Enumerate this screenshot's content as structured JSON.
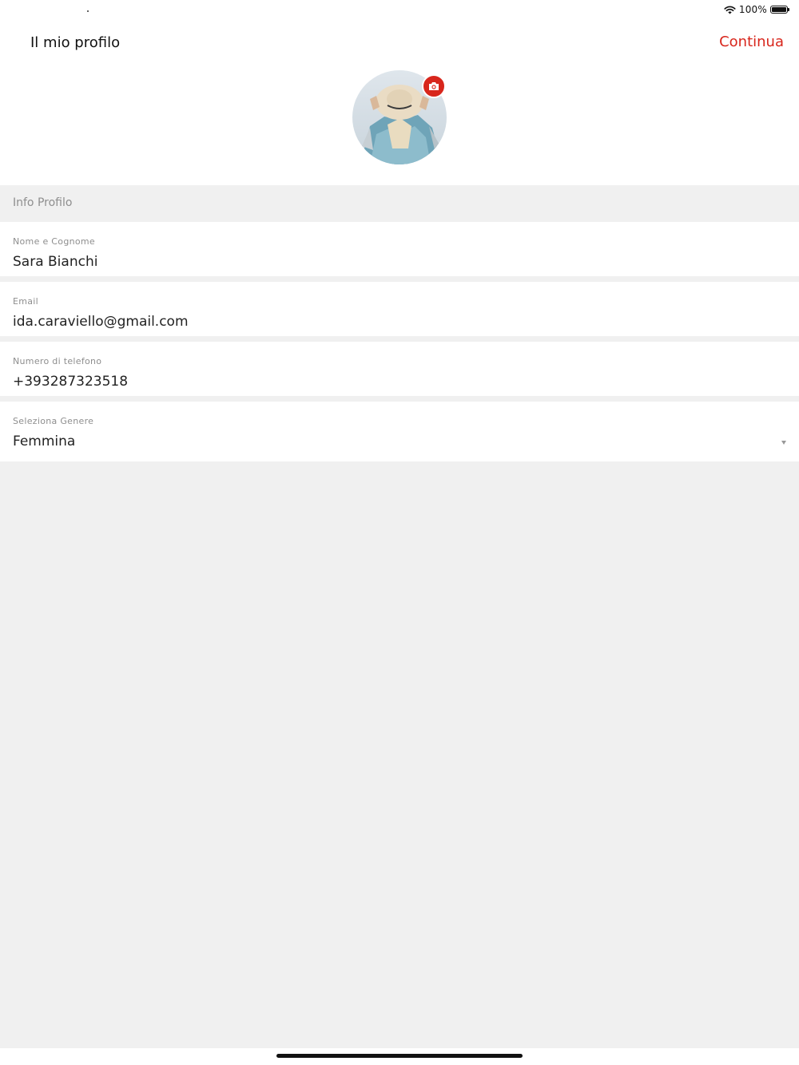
{
  "status_bar": {
    "battery_percent": "100%",
    "icons": [
      "wifi-icon",
      "battery-icon"
    ]
  },
  "header": {
    "title": "Il mio profilo",
    "continue_label": "Continua"
  },
  "avatar": {
    "icon": "camera-icon"
  },
  "section": {
    "title": "Info Profilo"
  },
  "fields": {
    "name": {
      "label": "Nome e Cognome",
      "value": "Sara Bianchi"
    },
    "email": {
      "label": "Email",
      "value": "ida.caraviello@gmail.com"
    },
    "phone": {
      "label": "Numero di telefono",
      "value": "+393287323518"
    },
    "gender": {
      "label": "Seleziona Genere",
      "value": "Femmina",
      "icon": "chevron-down-icon"
    }
  },
  "colors": {
    "accent": "#d8261c",
    "background": "#f0f0f0",
    "surface": "#ffffff",
    "label": "#8e8e8e"
  }
}
